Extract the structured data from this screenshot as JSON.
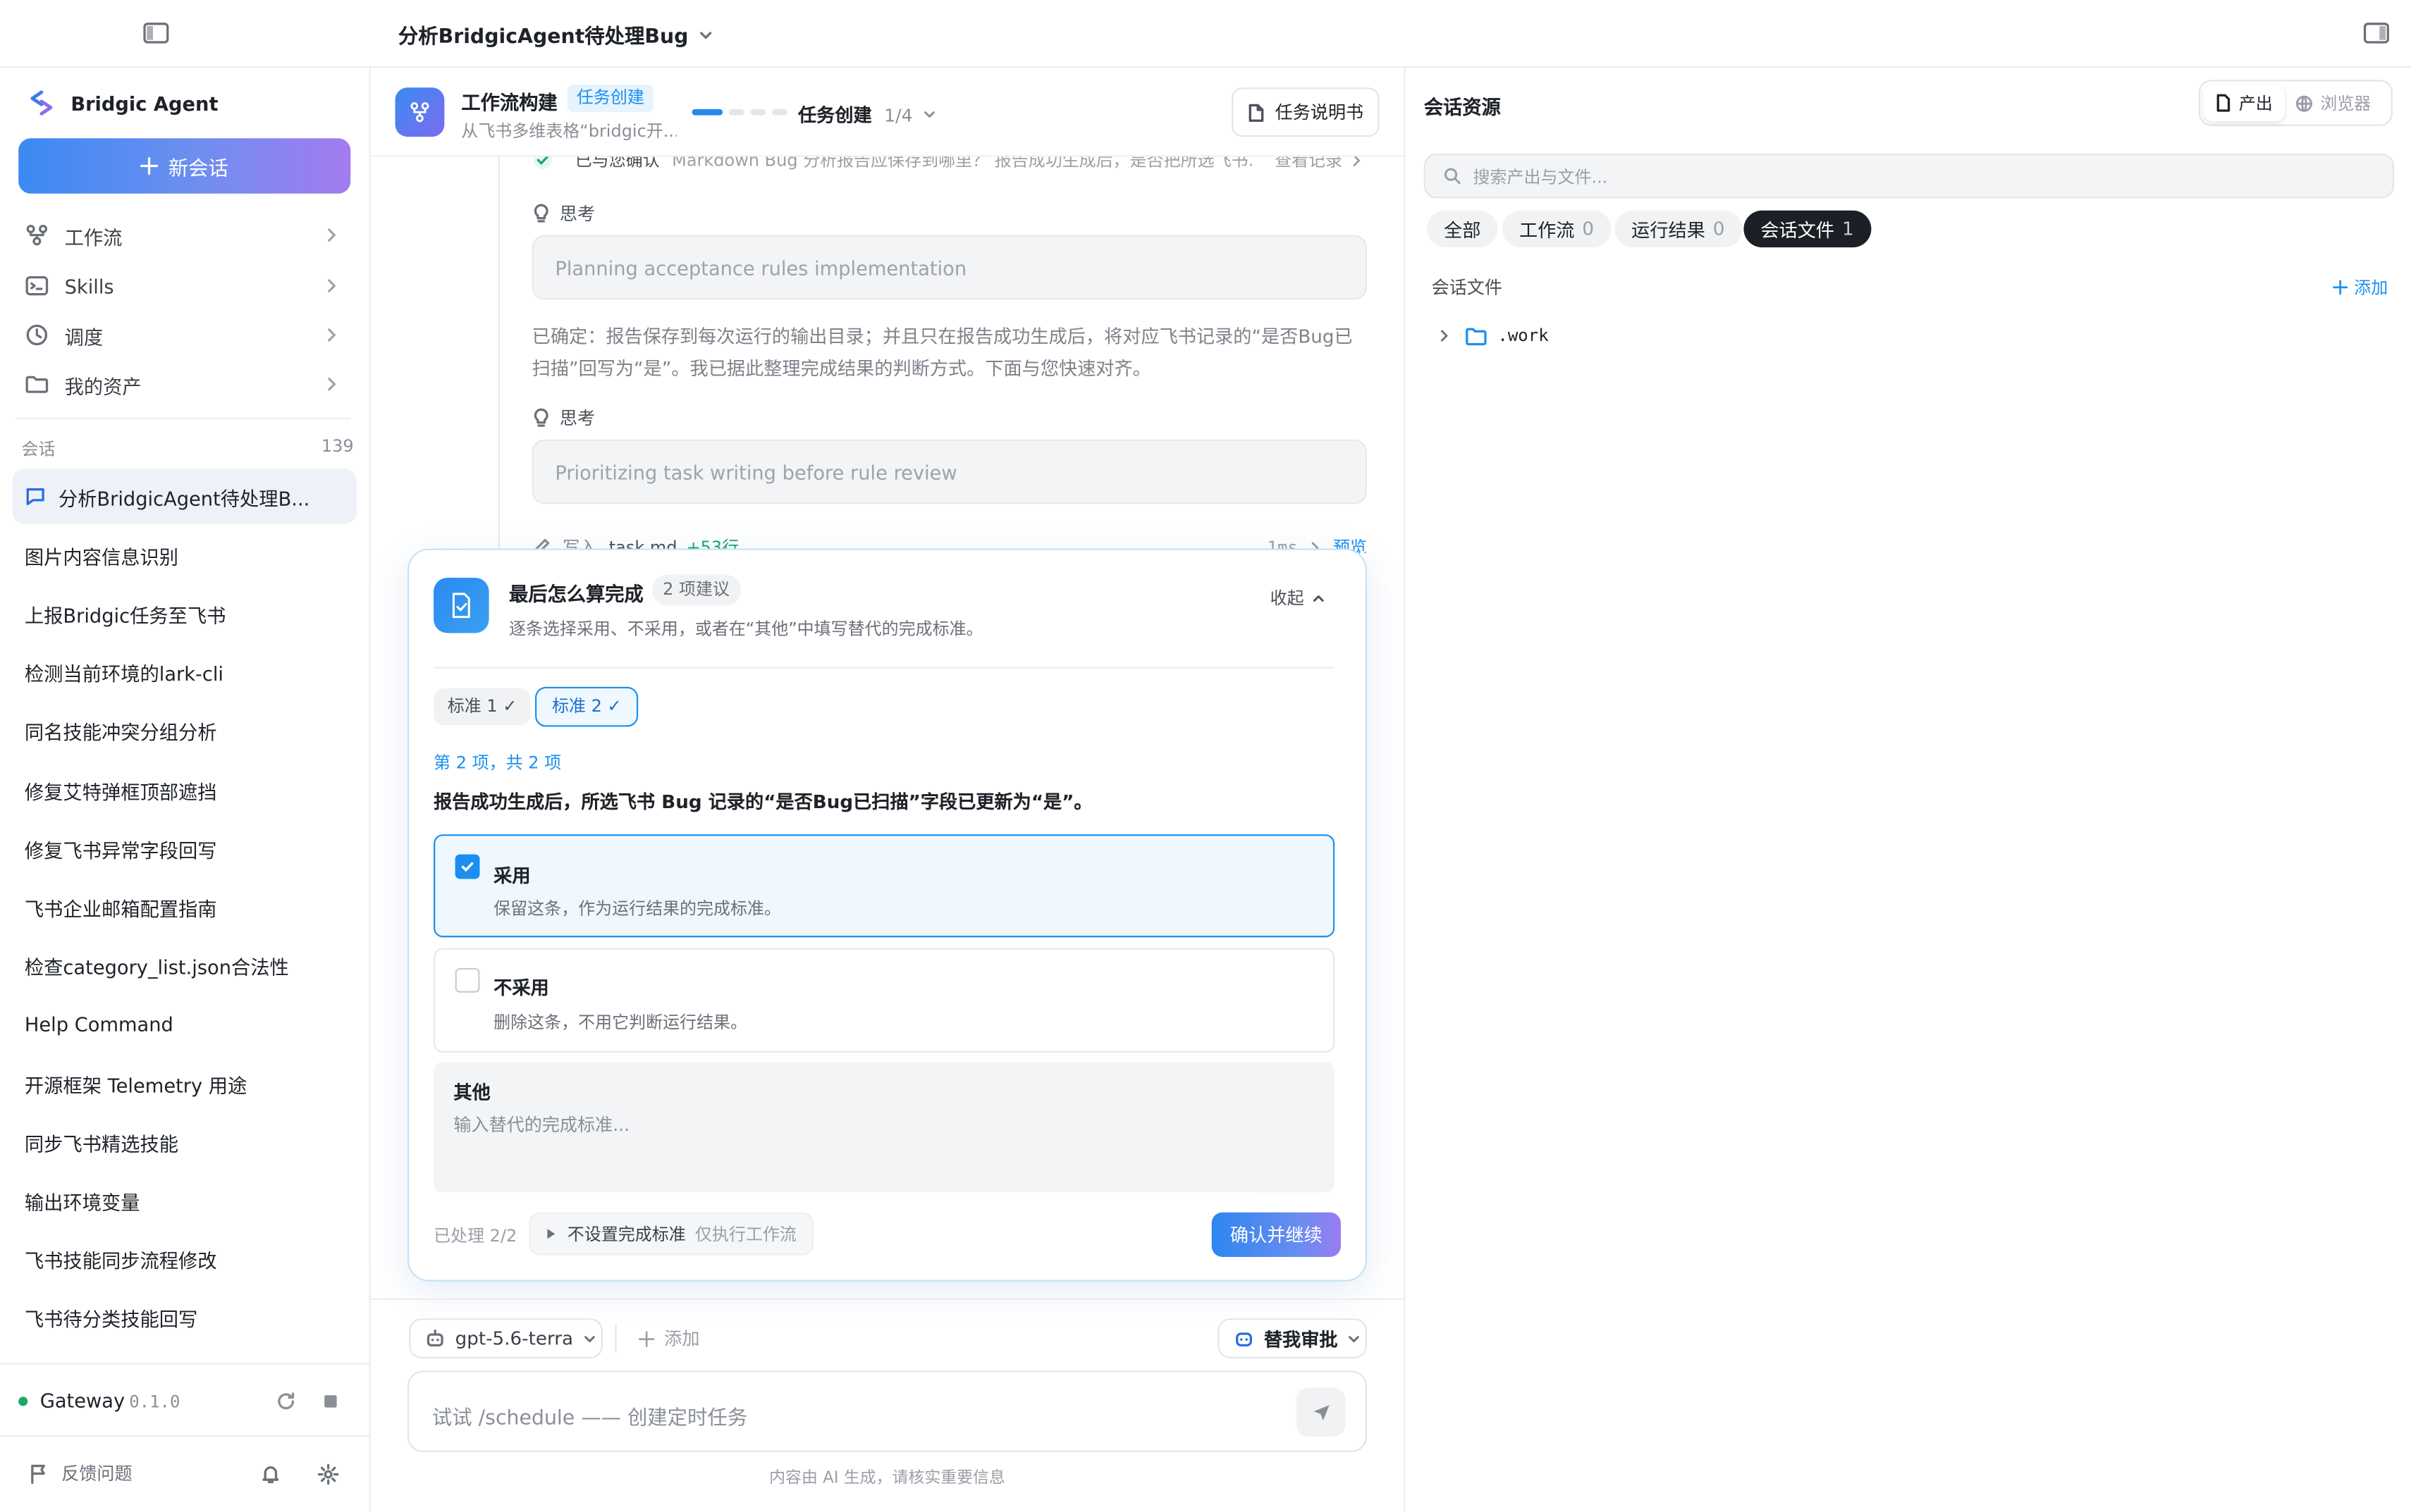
{
  "header": {
    "title": "分析BridgicAgent待处理Bug"
  },
  "sidebar": {
    "brand": "Bridgic Agent",
    "new_chat": "新会话",
    "nav": [
      {
        "label": "工作流",
        "icon": "workflow-icon"
      },
      {
        "label": "Skills",
        "icon": "terminal-icon"
      },
      {
        "label": "调度",
        "icon": "clock-icon"
      },
      {
        "label": "我的资产",
        "icon": "folder-icon"
      }
    ],
    "conversations_label": "会话",
    "conversations_count": "139",
    "conversations": [
      "分析BridgicAgent待处理B...",
      "图片内容信息识别",
      "上报Bridgic任务至飞书",
      "检测当前环境的lark-cli",
      "同名技能冲突分组分析",
      "修复艾特弹框顶部遮挡",
      "修复飞书异常字段回写",
      "飞书企业邮箱配置指南",
      "检查category_list.json合法性",
      "Help Command",
      "开源框架 Telemetry 用途",
      "同步飞书精选技能",
      "输出环境变量",
      "飞书技能同步流程修改",
      "飞书待分类技能回写"
    ],
    "gateway_label": "Gateway",
    "gateway_version": "0.1.0",
    "feedback": "反馈问题"
  },
  "workflow": {
    "title": "工作流构建",
    "badge": "任务创建",
    "subtitle": "从飞书多维表格“bridgic开...",
    "step_label": "任务创建",
    "step_count": "1/4",
    "spec_button": "任务说明书"
  },
  "chat": {
    "confirmed_text": "已与您确认",
    "confirmed_detail": "Markdown Bug 分析报告应保存到哪里？ 报告成功生成后，是否把所选飞书...",
    "view_records": "查看记录",
    "think_label": "思考",
    "think1": "Planning acceptance rules implementation",
    "message": "已确定：报告保存到每次运行的输出目录；并且只在报告成功生成后，将对应飞书记录的“是否Bug已扫描”回写为“是”。我已据此整理完成结果的判断方式。下面与您快速对齐。",
    "think2": "Prioritizing task writing before rule review",
    "write_prefix": "写入",
    "write_file": "task.md",
    "write_lines": "+53行",
    "write_time": "1ms",
    "preview": "预览"
  },
  "card": {
    "title": "最后怎么算完成",
    "suggest_badge": "2 项建议",
    "desc": "逐条选择采用、不采用，或者在“其他”中填写替代的完成标准。",
    "collapse": "收起",
    "tabs": [
      "标准 1 ✓",
      "标准 2 ✓"
    ],
    "progress": "第 2 项，共 2 项",
    "question": "报告成功生成后，所选飞书 Bug 记录的“是否Bug已扫描”字段已更新为“是”。",
    "adopt_title": "采用",
    "adopt_desc": "保留这条，作为运行结果的完成标准。",
    "reject_title": "不采用",
    "reject_desc": "删除这条，不用它判断运行结果。",
    "other_title": "其他",
    "other_placeholder": "输入替代的完成标准...",
    "processed": "已处理 2/2",
    "skip_label": "不设置完成标准",
    "skip_hint": "仅执行工作流",
    "confirm": "确认并继续"
  },
  "composer": {
    "model": "gpt-5.6-terra",
    "add": "添加",
    "approval": "替我审批",
    "placeholder": "试试 /schedule —— 创建定时任务",
    "disclaimer": "内容由 AI 生成，请核实重要信息"
  },
  "resources": {
    "title": "会话资源",
    "tab_output": "产出",
    "tab_browser": "浏览器",
    "search_placeholder": "搜索产出与文件...",
    "filters": [
      {
        "label": "全部",
        "count": ""
      },
      {
        "label": "工作流",
        "count": "0"
      },
      {
        "label": "运行结果",
        "count": "0"
      },
      {
        "label": "会话文件",
        "count": "1"
      }
    ],
    "section_label": "会话文件",
    "add": "添加",
    "tree": [
      ".work"
    ]
  },
  "colors": {
    "accent": "#1a8ff0",
    "gradient_start": "#3b8cf0",
    "gradient_end": "#a07af0",
    "active_chip": "#1c1f26",
    "selected_bg": "#eef8fe",
    "success": "#1aa869"
  }
}
